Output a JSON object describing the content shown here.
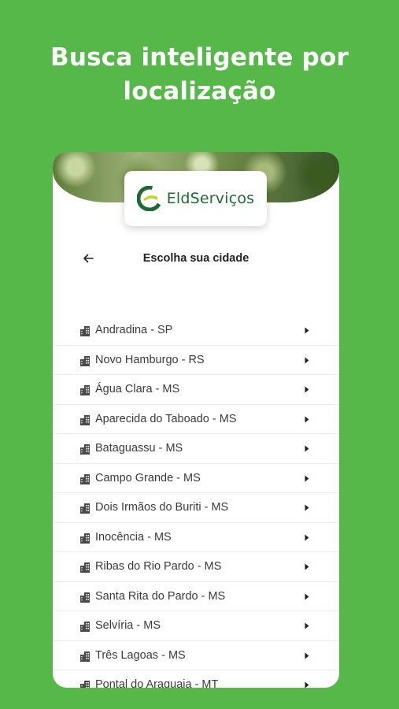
{
  "headline": {
    "line1": "Busca inteligente por",
    "line2": "localização"
  },
  "app": {
    "brand": "EldServiços",
    "screen_title": "Escolha sua cidade"
  },
  "colors": {
    "background": "#55b848",
    "brand_green": "#1d6a35",
    "accent_yellow": "#c7d22b"
  },
  "icons": {
    "back": "arrow-left-icon",
    "city": "building-icon",
    "chevron": "caret-right-icon"
  },
  "cities": [
    {
      "label": "Andradina - SP"
    },
    {
      "label": "Novo Hamburgo - RS"
    },
    {
      "label": "Água Clara - MS"
    },
    {
      "label": "Aparecida do Taboado - MS"
    },
    {
      "label": "Bataguassu - MS"
    },
    {
      "label": "Campo Grande - MS"
    },
    {
      "label": "Dois Irmãos do Buriti - MS"
    },
    {
      "label": "Inocência - MS"
    },
    {
      "label": "Ribas do Rio Pardo - MS"
    },
    {
      "label": "Santa Rita do Pardo - MS"
    },
    {
      "label": "Selvíria - MS"
    },
    {
      "label": "Três Lagoas - MS"
    },
    {
      "label": "Pontal do Araguaia - MT"
    }
  ]
}
